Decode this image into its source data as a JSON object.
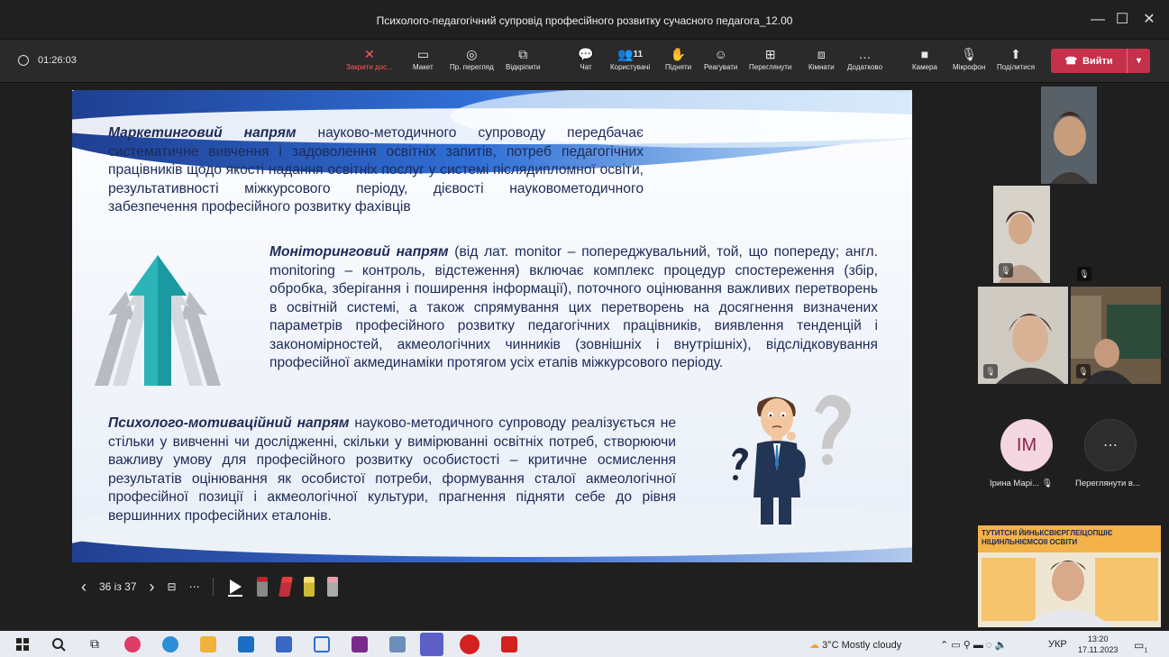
{
  "window": {
    "title": "Психолого-педагогічний супровід професійного розвитку сучасного педагога_12.00",
    "minimize": "—",
    "maximize": "☐",
    "close": "✕"
  },
  "meeting": {
    "timer": "01:26:03",
    "toolbar": [
      {
        "id": "stop-share",
        "label": "Закрити дос...",
        "icon": "✕"
      },
      {
        "id": "layout",
        "label": "Макет",
        "icon": "▭"
      },
      {
        "id": "presenter-view",
        "label": "Пр. перегляд",
        "icon": "◎"
      },
      {
        "id": "pop-out",
        "label": "Відкріпити",
        "icon": "⧉"
      },
      {
        "id": "chat",
        "label": "Чат",
        "icon": "💬"
      },
      {
        "id": "people",
        "label": "Користувачі",
        "icon": "👥"
      },
      {
        "id": "raise-hand",
        "label": "Підняти",
        "icon": "✋"
      },
      {
        "id": "react",
        "label": "Реагувати",
        "icon": "☺"
      },
      {
        "id": "view",
        "label": "Переглянути",
        "icon": "⊞"
      },
      {
        "id": "rooms",
        "label": "Кімнати",
        "icon": "⧈"
      },
      {
        "id": "more",
        "label": "Додатково",
        "icon": "…"
      },
      {
        "id": "camera",
        "label": "Камера",
        "icon": "■"
      },
      {
        "id": "mic",
        "label": "Мікрофон",
        "icon": "🎙"
      },
      {
        "id": "share",
        "label": "Поділитися",
        "icon": "⬆"
      }
    ],
    "people_count": "11",
    "leave_label": "Вийти",
    "leave_icon": "☎"
  },
  "slide": {
    "p1_bold": "Маркетинговий напрям",
    "p1_text": " науково-методичного супроводу передбачає систематичне вивчення і задоволення освітніх запитів, потреб педагогічних працівників щодо якості надання освітніх послуг у системі післядипломної освіти, результативності міжкурсового періоду, дієвості науковометодичного забезпечення професійного розвитку фахівців",
    "p2_bold": "Моніторинговий напрям",
    "p2_text": " (від лат. monitor – попереджувальний, той, що попереду; англ. monitoring – контроль, відстеження) включає комплекс процедур спостереження (збір, обробка, зберігання і поширення інформації), поточного оцінювання важливих перетворень в освітній системі, а також спрямування цих перетворень на досягнення визначених параметрів професійного розвитку педагогічних працівників, виявлення тенденцій і закономірностей, акмеологічних чинників (зовнішніх і внутрішніх), відслідковування професійної акмединаміки протягом усіх етапів міжкурсового періоду.",
    "p3_bold": "Психолого-мотиваційний напрям",
    "p3_text": " науково-методичного супроводу реалізується не стільки у вивченні чи дослідженні, скільки у вимірюванні освітніх потреб, створюючи важливу умову для професійного розвитку особистості – критичне осмислення результатів оцінювання як особистої потреби, формування сталої акмеологічної професійної позиції і акмеологічної культури, прагнення підняти себе до рівня вершинних професійних еталонів."
  },
  "slide_nav": {
    "prev": "‹",
    "counter": "36 із 37",
    "next": "›",
    "grid": "⊟",
    "more": "⋯"
  },
  "participants": {
    "avatar_initials": "IM",
    "avatar_name": "Ірина Марі...",
    "more_label": "Переглянути в...",
    "more_icon": "⋯",
    "presenter_banner": "ТУТИТСНІ ЙИНЬКСВІЄРГЛЕІЦОПШІЄ НІЦИНЛЬНІЄМСОІІ ОСВІТИ"
  },
  "taskbar": {
    "weather": "3°C  Mostly cloudy",
    "lang": "УКР",
    "time": "13:20",
    "date": "17.11.2023",
    "notif": "1"
  }
}
